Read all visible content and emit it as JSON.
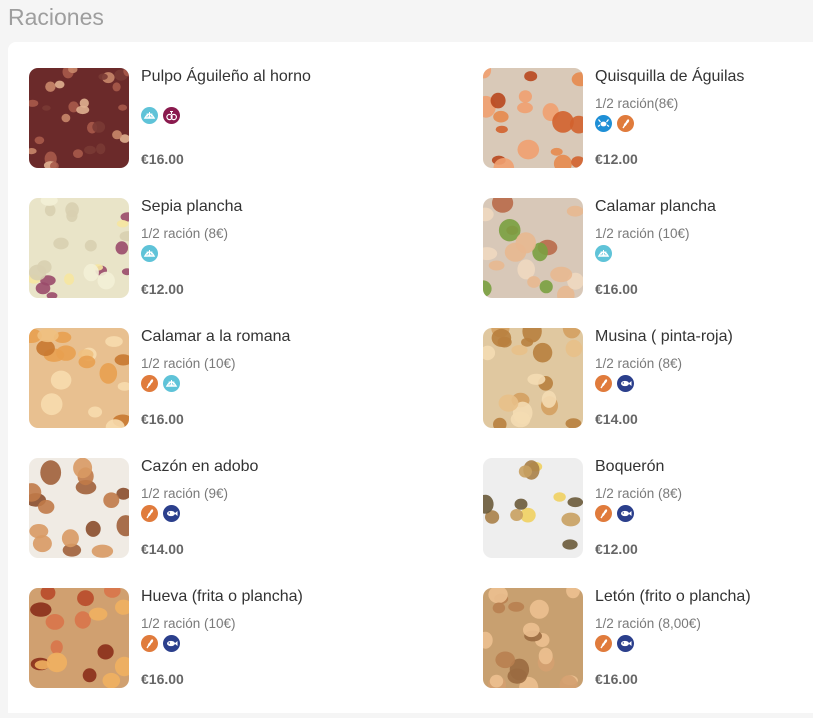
{
  "section": {
    "title": "Raciones"
  },
  "colors": {
    "mollusc": "#5fc3d8",
    "crustacean": "#1e8fd6",
    "gluten": "#e07b3c",
    "fish": "#2b3f8c",
    "sulphites": "#8a1a4e"
  },
  "items": [
    {
      "name": "Pulpo Águileño al horno",
      "half": "",
      "price": "€16.00",
      "icons": [
        "mollusc-icon",
        "sulphites-icon"
      ]
    },
    {
      "name": "Quisquilla de Águilas",
      "half": "1/2 ración(8€)",
      "price": "€12.00",
      "icons": [
        "crustacean-icon",
        "gluten-icon"
      ]
    },
    {
      "name": "Sepia plancha",
      "half": "1/2 ración (8€)",
      "price": "€12.00",
      "icons": [
        "mollusc-icon"
      ]
    },
    {
      "name": "Calamar plancha",
      "half": "1/2 ración (10€)",
      "price": "€16.00",
      "icons": [
        "mollusc-icon"
      ]
    },
    {
      "name": "Calamar a la romana",
      "half": "1/2 ración (10€)",
      "price": "€16.00",
      "icons": [
        "gluten-icon",
        "mollusc-icon"
      ]
    },
    {
      "name": "Musina ( pinta-roja)",
      "half": "1/2 ración (8€)",
      "price": "€14.00",
      "icons": [
        "gluten-icon",
        "fish-icon"
      ]
    },
    {
      "name": "Cazón en adobo",
      "half": "1/2 ración (9€)",
      "price": "€14.00",
      "icons": [
        "gluten-icon",
        "fish-icon"
      ]
    },
    {
      "name": "Boquerón",
      "half": "1/2 ración (8€)",
      "price": "€12.00",
      "icons": [
        "gluten-icon",
        "fish-icon"
      ]
    },
    {
      "name": "Hueva (frita o plancha)",
      "half": "1/2 ración (10€)",
      "price": "€16.00",
      "icons": [
        "gluten-icon",
        "fish-icon"
      ]
    },
    {
      "name": "Letón (frito o plancha)",
      "half": "1/2 ración (8,00€)",
      "price": "€16.00",
      "icons": [
        "gluten-icon",
        "fish-icon"
      ]
    }
  ]
}
